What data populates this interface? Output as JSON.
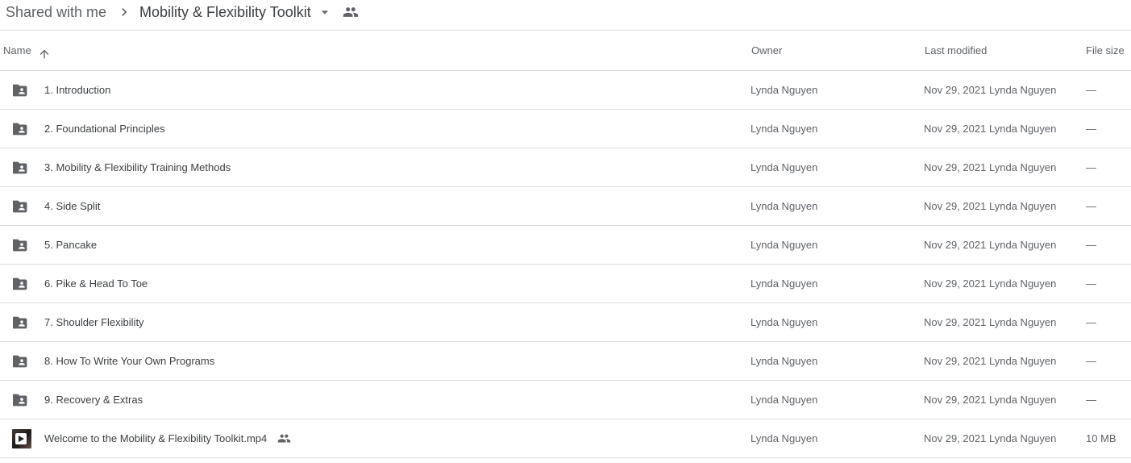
{
  "breadcrumb": {
    "root": "Shared with me",
    "separator_icon": "chevron-right-icon",
    "current": "Mobility & Flexibility Toolkit",
    "dropdown_icon": "caret-down-icon",
    "shared_icon": "people-icon"
  },
  "columns": {
    "name": "Name",
    "sort_icon": "arrow-up-icon",
    "owner": "Owner",
    "last_modified": "Last modified",
    "file_size": "File size"
  },
  "files": [
    {
      "name": "1. Introduction",
      "type": "shared-folder",
      "icon": "shared-folder-icon",
      "owner": "Lynda Nguyen",
      "modified_date": "Nov 29, 2021",
      "modified_by": "Lynda Nguyen",
      "size": "—"
    },
    {
      "name": "2. Foundational Principles",
      "type": "shared-folder",
      "icon": "shared-folder-icon",
      "owner": "Lynda Nguyen",
      "modified_date": "Nov 29, 2021",
      "modified_by": "Lynda Nguyen",
      "size": "—"
    },
    {
      "name": "3. Mobility & Flexibility Training Methods",
      "type": "shared-folder",
      "icon": "shared-folder-icon",
      "owner": "Lynda Nguyen",
      "modified_date": "Nov 29, 2021",
      "modified_by": "Lynda Nguyen",
      "size": "—"
    },
    {
      "name": "4. Side Split",
      "type": "shared-folder",
      "icon": "shared-folder-icon",
      "owner": "Lynda Nguyen",
      "modified_date": "Nov 29, 2021",
      "modified_by": "Lynda Nguyen",
      "size": "—"
    },
    {
      "name": "5. Pancake",
      "type": "shared-folder",
      "icon": "shared-folder-icon",
      "owner": "Lynda Nguyen",
      "modified_date": "Nov 29, 2021",
      "modified_by": "Lynda Nguyen",
      "size": "—"
    },
    {
      "name": "6. Pike & Head To Toe",
      "type": "shared-folder",
      "icon": "shared-folder-icon",
      "owner": "Lynda Nguyen",
      "modified_date": "Nov 29, 2021",
      "modified_by": "Lynda Nguyen",
      "size": "—"
    },
    {
      "name": "7. Shoulder Flexibility",
      "type": "shared-folder",
      "icon": "shared-folder-icon",
      "owner": "Lynda Nguyen",
      "modified_date": "Nov 29, 2021",
      "modified_by": "Lynda Nguyen",
      "size": "—"
    },
    {
      "name": "8. How To Write Your Own Programs",
      "type": "shared-folder",
      "icon": "shared-folder-icon",
      "owner": "Lynda Nguyen",
      "modified_date": "Nov 29, 2021",
      "modified_by": "Lynda Nguyen",
      "size": "—"
    },
    {
      "name": "9. Recovery & Extras",
      "type": "shared-folder",
      "icon": "shared-folder-icon",
      "owner": "Lynda Nguyen",
      "modified_date": "Nov 29, 2021",
      "modified_by": "Lynda Nguyen",
      "size": "—"
    },
    {
      "name": "Welcome to the Mobility & Flexibility Toolkit.mp4",
      "type": "video",
      "icon": "video-thumbnail-icon",
      "shared": true,
      "owner": "Lynda Nguyen",
      "modified_date": "Nov 29, 2021",
      "modified_by": "Lynda Nguyen",
      "size": "10 MB"
    }
  ],
  "colors": {
    "icon_gray": "#5f6368",
    "divider": "#dadce0",
    "primary_text": "#3c4043",
    "secondary_text": "#5f6368"
  }
}
